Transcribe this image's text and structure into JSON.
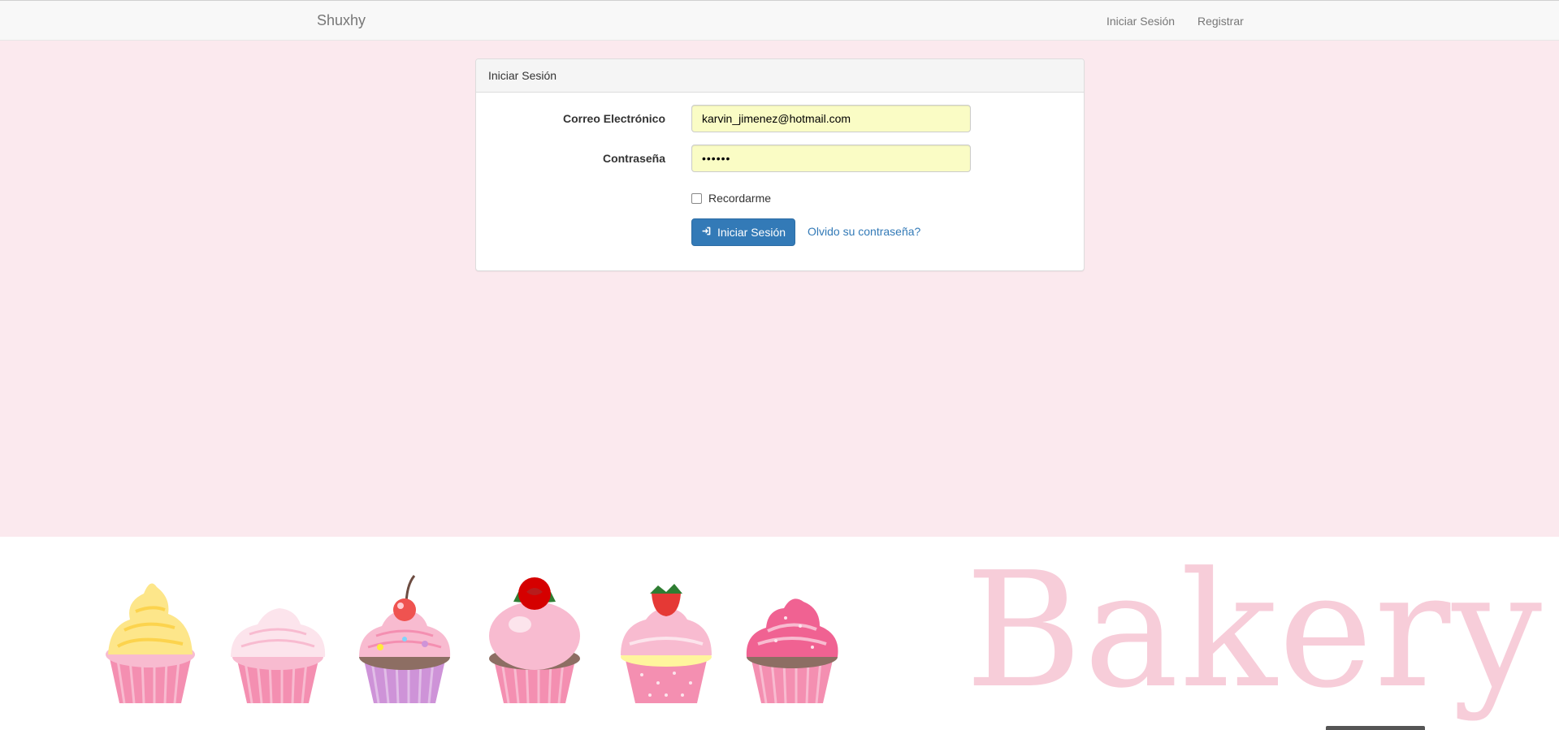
{
  "navbar": {
    "brand": "Shuxhy",
    "login_link": "Iniciar Sesión",
    "register_link": "Registrar"
  },
  "login_panel": {
    "heading": "Iniciar Sesión",
    "email_label": "Correo Electrónico",
    "email_value": "karvin_jimenez@hotmail.com",
    "password_label": "Contraseña",
    "password_value": "••••••",
    "remember_label": "Recordarme",
    "remember_checked": false,
    "submit_label": "Iniciar Sesión",
    "forgot_link": "Olvido su contraseña?"
  },
  "banner": {
    "word": "Bakery",
    "cupcakes": [
      "vanilla-swirl",
      "white-frosting",
      "cherry-top",
      "rose-top",
      "strawberry-top",
      "pink-sprinkles"
    ]
  },
  "colors": {
    "page_background": "#fbe9ee",
    "primary": "#337ab7",
    "autofill": "#fafcc5",
    "bakery_text": "#f7cdd9"
  }
}
